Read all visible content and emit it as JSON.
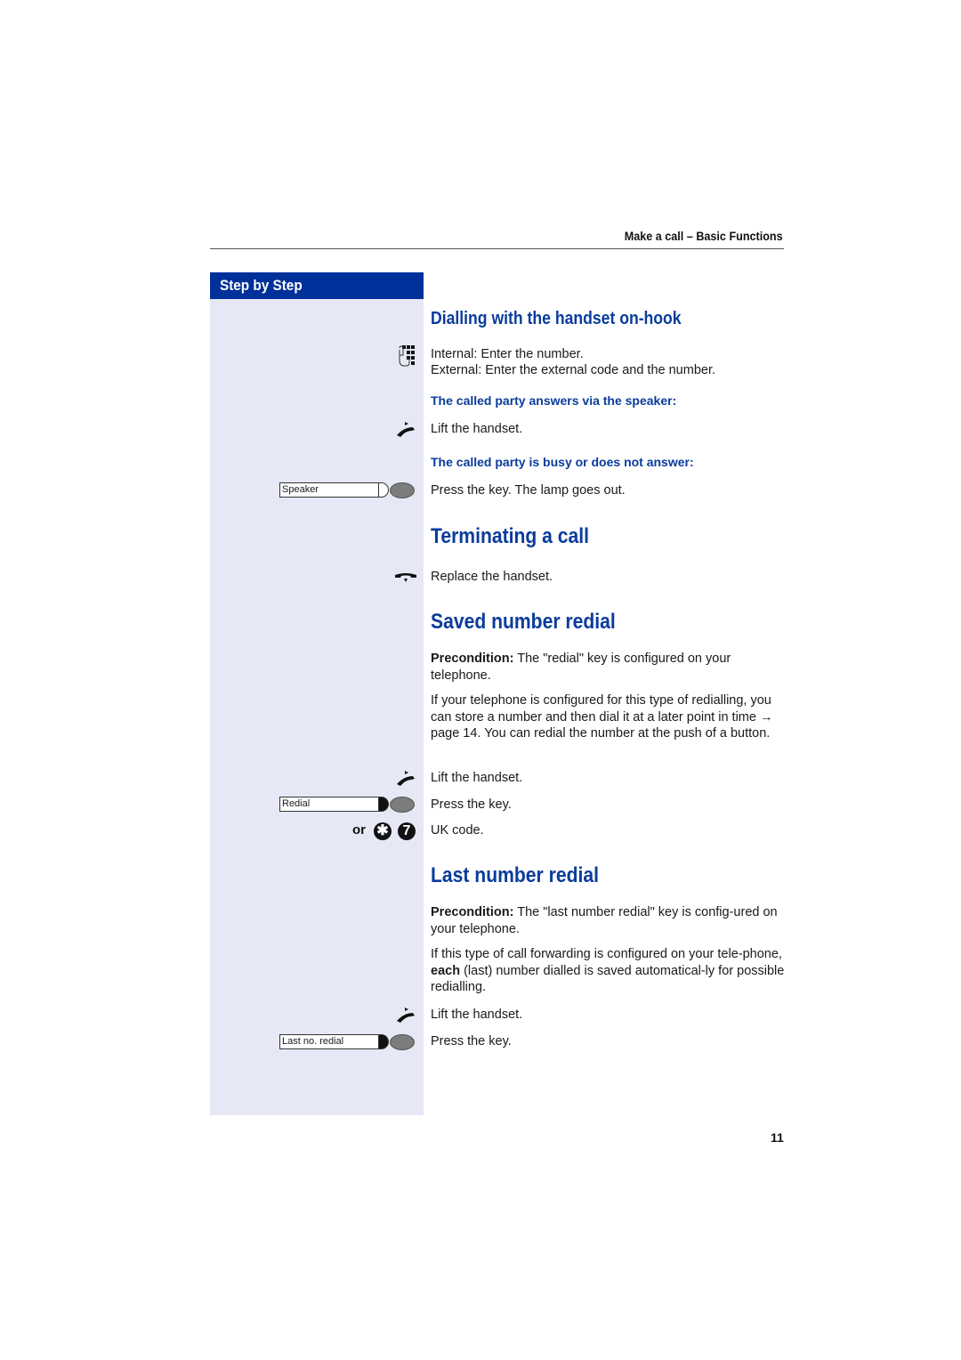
{
  "header": {
    "title": "Make a call – Basic Functions"
  },
  "sidebar": {
    "title": "Step by Step"
  },
  "sections": {
    "dialling": {
      "heading": "Dialling with the handset on-hook",
      "internal": "Internal: Enter the number.",
      "external": "External: Enter the external code and the number.",
      "sub1": "The called party answers via the speaker:",
      "lift": "Lift the handset.",
      "sub2": "The called party is busy or does not answer:",
      "press": "Press the key. The lamp goes out.",
      "key_label": "Speaker"
    },
    "terminating": {
      "heading": "Terminating a call",
      "replace": "Replace the handset."
    },
    "saved": {
      "heading": "Saved number redial",
      "precondition_label": "Precondition:",
      "precondition_text": " The \"redial\" key is configured on your telephone.",
      "body": "If your telephone is configured for this type of redialling, you can store a number and then dial it at a later point in time → page 14. You can redial the number at the push of a button.",
      "lift": "Lift the handset.",
      "press": "Press the key.",
      "uk": "UK code.",
      "key_label": "Redial",
      "or_label": "or",
      "star_key": "✱",
      "seven_key": "7"
    },
    "last": {
      "heading": "Last number redial",
      "precondition_label": "Precondition:",
      "precondition_text": " The \"last number redial\" key is config-ured on your telephone.",
      "body_pre": "If this type of call forwarding is configured on your tele-phone, ",
      "body_bold": "each",
      "body_post": " (last) number dialled is saved automatical-ly for possible redialling.",
      "lift": "Lift the handset.",
      "press": "Press the key.",
      "key_label": "Last no. redial"
    }
  },
  "footer": {
    "page_number": "11"
  }
}
